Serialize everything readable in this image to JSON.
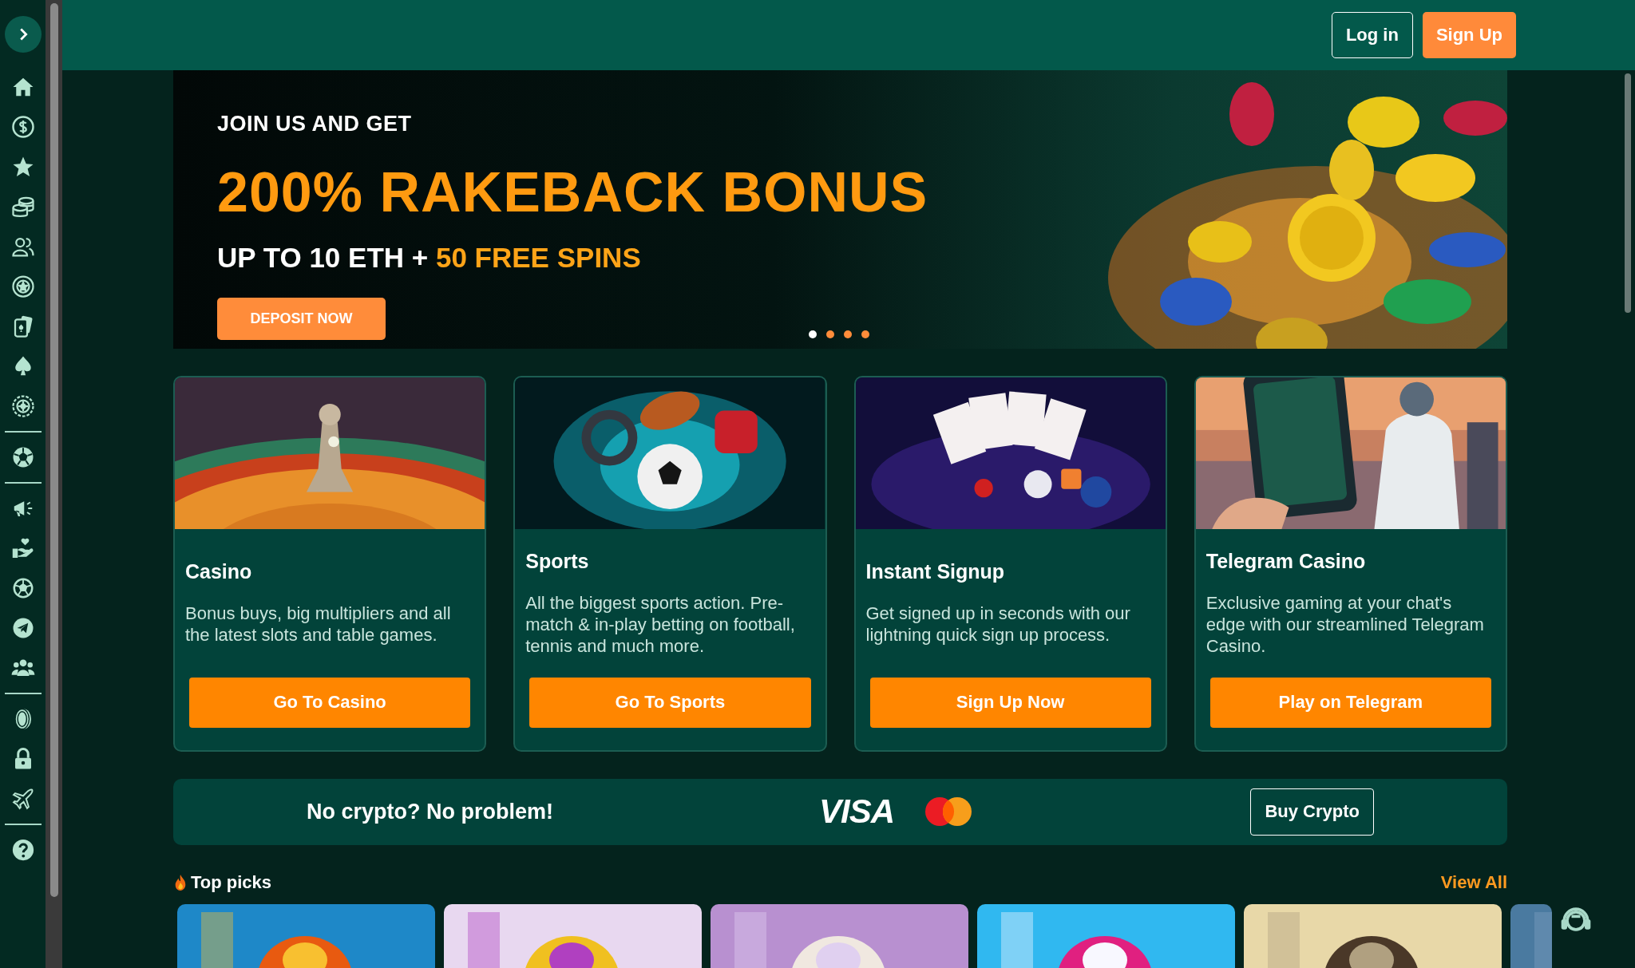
{
  "header": {
    "buttons": [
      {
        "label": "Log in",
        "kind": "outline"
      },
      {
        "label": "Sign Up",
        "kind": "primary"
      }
    ]
  },
  "banner": {
    "eyebrow": "JOIN US AND GET",
    "headline": "200% RAKEBACK BONUS",
    "subtitle": "UP TO 10 ETH +",
    "highlight": "50 FREE SPINS",
    "button": "DEPOSIT NOW",
    "dots": [
      {
        "selected": true
      },
      {
        "selected": false
      },
      {
        "selected": false
      },
      {
        "selected": false
      }
    ]
  },
  "cards": [
    {
      "title": "Casino",
      "description": "Bonus buys, big multipliers and all the latest slots and table games.",
      "button": "Go To Casino",
      "kind": "picture"
    },
    {
      "title": "Sports",
      "description": "All the biggest sports action. Pre-match & in-play betting on football, tennis and much more.",
      "button": "Go To Sports",
      "kind": "picture"
    },
    {
      "title": "Instant Signup",
      "description": "Get signed up in seconds with our lightning quick sign up process.",
      "button": "Sign Up Now",
      "kind": "picture"
    },
    {
      "title": "Telegram Casino",
      "description": "Exclusive gaming at your chat's edge with our streamlined Telegram Casino.",
      "button": "Play on Telegram",
      "kind": "picture"
    }
  ],
  "crypto_bar": {
    "text": "No crypto? No problem!",
    "visa": "VISA",
    "button": "Buy Crypto"
  },
  "top_picks": {
    "title": "Top picks",
    "link": "View All"
  }
}
